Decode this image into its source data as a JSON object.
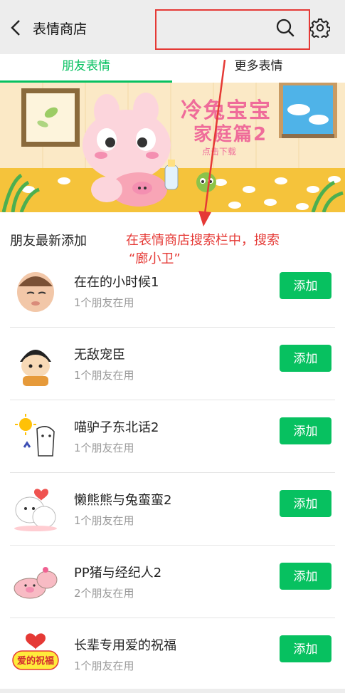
{
  "header": {
    "title": "表情商店",
    "back_icon": "chevron-left-icon",
    "search_icon": "search-icon",
    "settings_icon": "gear-icon"
  },
  "tabs": [
    {
      "label": "朋友表情",
      "active": true
    },
    {
      "label": "更多表情",
      "active": false
    }
  ],
  "banner": {
    "title_line1": "冷兔宝宝",
    "title_line2": "家庭篇2",
    "cta": "点击下载"
  },
  "section": {
    "title": "朋友最新添加"
  },
  "items": [
    {
      "name": "在在的小时候1",
      "users": "1个朋友在用",
      "button": "添加"
    },
    {
      "name": "无敌宠臣",
      "users": "1个朋友在用",
      "button": "添加"
    },
    {
      "name": "喵驴子东北话2",
      "users": "1个朋友在用",
      "button": "添加"
    },
    {
      "name": "懒熊熊与兔蛮蛮2",
      "users": "1个朋友在用",
      "button": "添加"
    },
    {
      "name": "PP猪与经纪人2",
      "users": "2个朋友在用",
      "button": "添加"
    },
    {
      "name": "长辈专用爱的祝福",
      "users": "1个朋友在用",
      "button": "添加"
    }
  ],
  "thumb_text": {
    "item6": "爱的祝福"
  },
  "annotation": {
    "line1": "在表情商店搜索栏中，搜索",
    "line2": "“廊小卫”"
  },
  "colors": {
    "accent": "#07c160",
    "annotation": "#e53935"
  }
}
